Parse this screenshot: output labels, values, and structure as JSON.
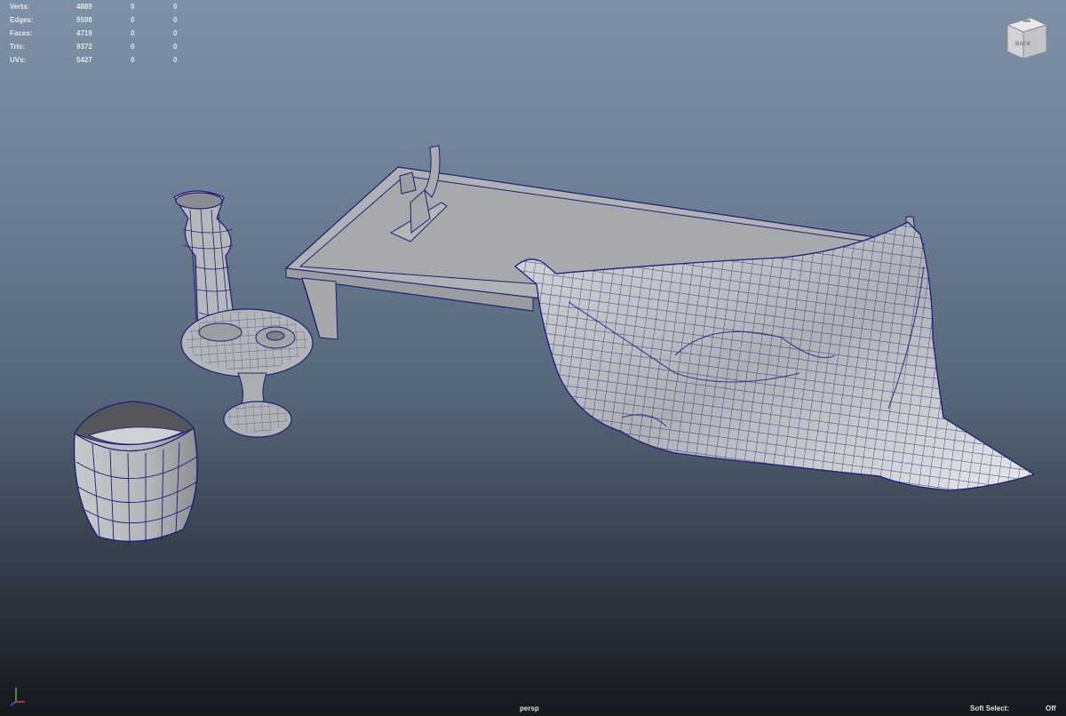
{
  "hud": {
    "rows": [
      {
        "label": "Verts:",
        "v1": "4889",
        "v2": "0",
        "v3": "0"
      },
      {
        "label": "Edges:",
        "v1": "9598",
        "v2": "0",
        "v3": "0"
      },
      {
        "label": "Faces:",
        "v1": "4719",
        "v2": "0",
        "v3": "0"
      },
      {
        "label": "Tris:",
        "v1": "9372",
        "v2": "0",
        "v3": "0"
      },
      {
        "label": "UVs:",
        "v1": "5427",
        "v2": "0",
        "v3": "0"
      }
    ]
  },
  "viewcube": {
    "face_label": "BACK"
  },
  "camera": {
    "name": "persp"
  },
  "soft_select": {
    "label": "Soft Select:",
    "value": "Off"
  },
  "colors": {
    "mesh_fill": "#b7b9bd",
    "wire": "#1e1e78",
    "hud_text": "#e6e6e6"
  }
}
